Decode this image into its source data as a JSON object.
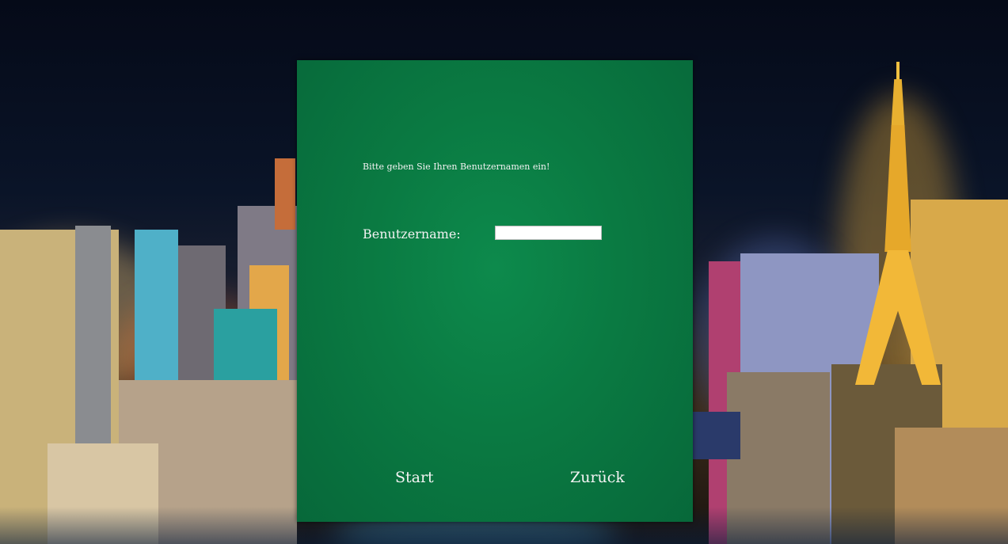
{
  "background": {
    "scene": "city-at-night",
    "colors": {
      "sky": "#050a18",
      "panel": "#0a7a42",
      "text": "#f2f2f2"
    }
  },
  "login": {
    "prompt": "Bitte geben Sie Ihren Benutzernamen ein!",
    "username_label": "Benutzername:",
    "username_value": "",
    "start_label": "Start",
    "back_label": "Zurück"
  }
}
